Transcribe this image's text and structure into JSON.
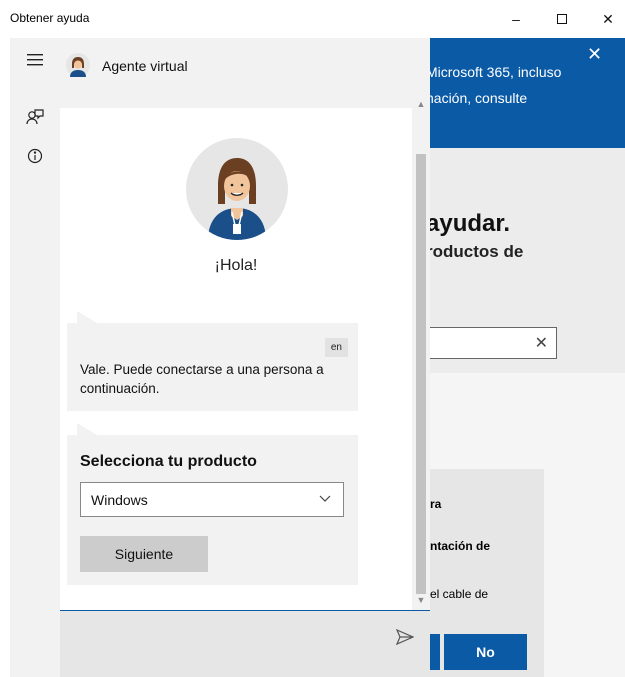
{
  "window": {
    "title": "Obtener ayuda",
    "minimize_glyph": "–",
    "close_glyph": "✕"
  },
  "rail": {
    "icons": [
      "hamburger-menu-icon",
      "contact-support-icon",
      "info-icon"
    ]
  },
  "chat": {
    "agent_name": "Agente virtual",
    "greeting": "¡Hola!",
    "message": {
      "language_badge": "en",
      "text": "Vale. Puede conectarse a una persona a continuación."
    },
    "product_card": {
      "title": "Selecciona tu producto",
      "selected": "Windows",
      "next_button": "Siguiente"
    },
    "input_placeholder": ""
  },
  "background_page": {
    "banner_line1": "Microsoft 365, incluso",
    "banner_line2": "nación, consulte",
    "heading": "ayudar.",
    "subheading": "roductos de",
    "card_line1": "ra",
    "card_line2": "ntación de",
    "card_line3": "el cable de",
    "no_button": "No"
  },
  "colors": {
    "accent": "#0a5aa6",
    "panel": "#f2f2f2",
    "button_gray": "#cccccc"
  }
}
